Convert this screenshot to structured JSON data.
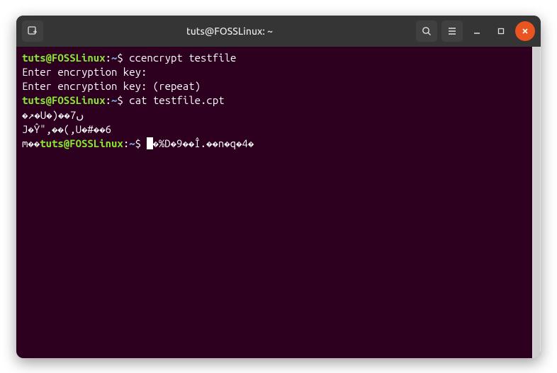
{
  "titlebar": {
    "title": "tuts@FOSSLinux: ~"
  },
  "terminal": {
    "lines": [
      {
        "type": "prompt",
        "user": "tuts@FOSSLinux",
        "path": "~",
        "symbol": "$",
        "command": "ccencrypt testfile"
      },
      {
        "type": "output",
        "text": "Enter encryption key:"
      },
      {
        "type": "output",
        "text": "Enter encryption key: (repeat)"
      },
      {
        "type": "prompt",
        "user": "tuts@FOSSLinux",
        "path": "~",
        "symbol": "$",
        "command": "cat testfile.cpt"
      },
      {
        "type": "output",
        "text": "�↗�U�)��7ں"
      },
      {
        "type": "output",
        "text": "J�Ŷ\",��(,U�#��6"
      },
      {
        "type": "prompt-garbage",
        "prefix": "m��",
        "user": "tuts@FOSSLinux",
        "path": "~",
        "symbol": "$",
        "command_after_cursor": "�%D�9��Î.��n�q�4�"
      }
    ]
  }
}
